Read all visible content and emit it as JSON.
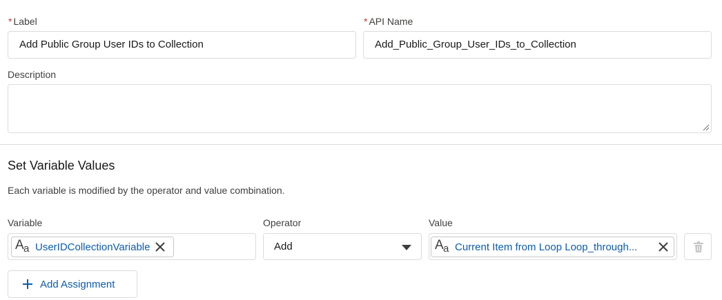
{
  "label_field": {
    "required_mark": "*",
    "label": "Label",
    "value": "Add Public Group User IDs to Collection"
  },
  "api_name_field": {
    "required_mark": "*",
    "label": "API Name",
    "value": "Add_Public_Group_User_IDs_to_Collection"
  },
  "description_field": {
    "label": "Description",
    "value": ""
  },
  "set_variable_section": {
    "title": "Set Variable Values",
    "help": "Each variable is modified by the operator and value combination."
  },
  "assignment_row": {
    "variable_header": "Variable",
    "operator_header": "Operator",
    "value_header": "Value",
    "variable_value": "UserIDCollectionVariable",
    "operator_value": "Add",
    "value_value": "Current Item from Loop Loop_through...",
    "variable_icon": "text-data-type-icon",
    "value_icon": "text-data-type-icon"
  },
  "add_assignment": {
    "label": "Add Assignment"
  },
  "colors": {
    "link_blue": "#0b5cab",
    "required_red": "#c23934",
    "border": "#dddbda"
  }
}
